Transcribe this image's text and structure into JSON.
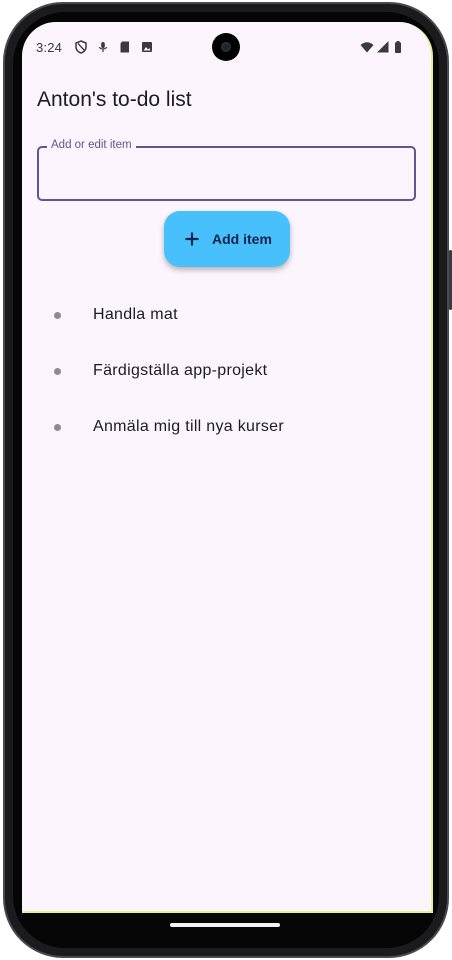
{
  "status_bar": {
    "time": "3:24",
    "left_icons": [
      "shield-icon",
      "mic-icon",
      "sd-card-icon",
      "photo-icon"
    ],
    "right_icons": [
      "wifi-icon",
      "signal-icon",
      "battery-icon"
    ]
  },
  "app": {
    "title": "Anton's to-do list"
  },
  "input": {
    "label": "Add or edit item",
    "value": ""
  },
  "add_button": {
    "icon": "plus-icon",
    "label": "Add item"
  },
  "todo_items": [
    {
      "text": "Handla mat"
    },
    {
      "text": "Färdigställa app-projekt"
    },
    {
      "text": "Anmäla mig till nya kurser"
    }
  ],
  "colors": {
    "background": "#fcf5fd",
    "accent_outline": "#65558f",
    "button": "#48c0fb",
    "button_text": "#14234a"
  }
}
